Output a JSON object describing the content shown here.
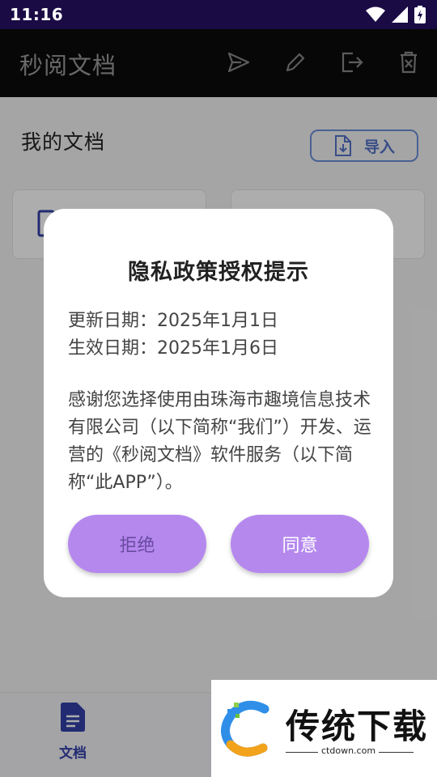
{
  "status_bar": {
    "time": "11:16"
  },
  "app_bar": {
    "title": "秒阅文档",
    "actions": [
      "send-icon",
      "edit-icon",
      "export-icon",
      "delete-icon"
    ]
  },
  "main": {
    "section_title": "我的文档",
    "import_button": "导入"
  },
  "bottom_nav": {
    "items": [
      {
        "label": "文档",
        "icon": "document-icon"
      }
    ]
  },
  "dialog": {
    "title": "隐私政策授权提示",
    "update_date": "更新日期：2025年1月1日",
    "effective_date": "生效日期：2025年1月6日",
    "body": "感谢您选择使用由珠海市趣境信息技术有限公司（以下简称“我们”）开发、运营的《秒阅文档》软件服务（以下简称“此APP”）。",
    "reject_button": "拒绝",
    "agree_button": "同意"
  },
  "watermark": {
    "name": "传统下载",
    "url": "ctdown.com"
  },
  "colors": {
    "status_bar": "#1a0b45",
    "app_bar": "#0b0b0b",
    "button_purple": "#b588ee",
    "import_blue": "#5573c8",
    "nav_blue": "#3340a8"
  }
}
